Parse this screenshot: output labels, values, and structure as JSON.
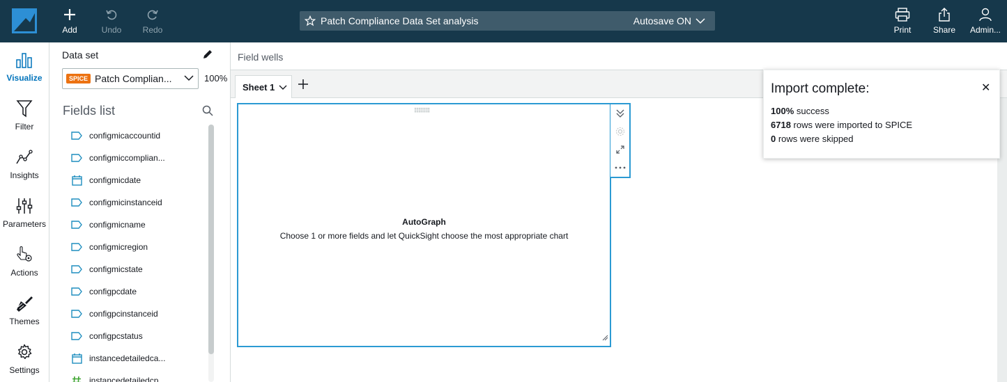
{
  "topbar": {
    "add_label": "Add",
    "undo_label": "Undo",
    "redo_label": "Redo",
    "analysis_title": "Patch Compliance Data Set analysis",
    "autosave_label": "Autosave ON",
    "print_label": "Print",
    "share_label": "Share",
    "user_label": "Admin..."
  },
  "leftnav": {
    "items": [
      {
        "label": "Visualize",
        "icon": "bar-chart-icon"
      },
      {
        "label": "Filter",
        "icon": "funnel-icon"
      },
      {
        "label": "Insights",
        "icon": "insights-icon"
      },
      {
        "label": "Parameters",
        "icon": "sliders-icon"
      },
      {
        "label": "Actions",
        "icon": "pointer-gear-icon"
      },
      {
        "label": "Themes",
        "icon": "paintbrush-icon"
      },
      {
        "label": "Settings",
        "icon": "gear-icon"
      }
    ]
  },
  "datapanel": {
    "dataset_label": "Data set",
    "spice_badge": "SPICE",
    "dataset_name": "Patch Complian...",
    "spice_percent": "100%",
    "fields_title": "Fields list",
    "fields": [
      {
        "name": "configmicaccountid",
        "type": "dimension"
      },
      {
        "name": "configmiccomplian...",
        "type": "dimension"
      },
      {
        "name": "configmicdate",
        "type": "date"
      },
      {
        "name": "configmicinstanceid",
        "type": "dimension"
      },
      {
        "name": "configmicname",
        "type": "dimension"
      },
      {
        "name": "configmicregion",
        "type": "dimension"
      },
      {
        "name": "configmicstate",
        "type": "dimension"
      },
      {
        "name": "configpcdate",
        "type": "dimension"
      },
      {
        "name": "configpcinstanceid",
        "type": "dimension"
      },
      {
        "name": "configpcstatus",
        "type": "dimension"
      },
      {
        "name": "instancedetailedca...",
        "type": "date"
      },
      {
        "name": "instancedetailedcp...",
        "type": "measure"
      }
    ]
  },
  "fieldwells_label": "Field wells",
  "sheet_tab_label": "Sheet 1",
  "visual": {
    "title": "AutoGraph",
    "description": "Choose 1 or more fields and let QuickSight choose the most appropriate chart"
  },
  "toast": {
    "title": "Import complete:",
    "line1_value": "100%",
    "line1_text": " success",
    "line2_value": "6718",
    "line2_text": " rows were imported to SPICE",
    "line3_value": "0",
    "line3_text": " rows were skipped"
  },
  "colors": {
    "topbar_bg": "#16384b",
    "accent_blue": "#0073bb",
    "visual_border": "#2b9ad3",
    "spice_orange": "#ec7211",
    "dimension_icon": "#1f8ebf",
    "measure_icon": "#3fa532"
  }
}
